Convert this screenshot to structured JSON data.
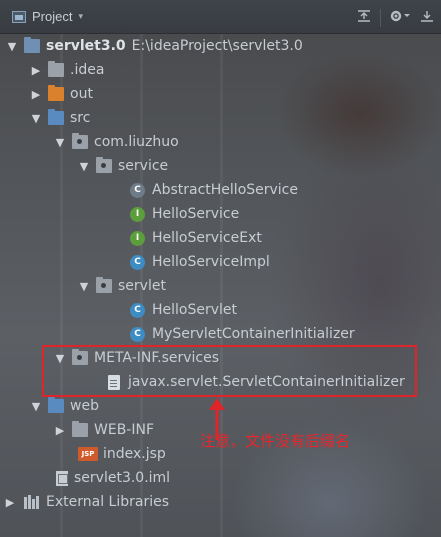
{
  "toolbar": {
    "title": "Project",
    "dropdown_caret": "▾",
    "icons": [
      "collapse-all-icon",
      "settings-icon",
      "hide-icon"
    ]
  },
  "tree": [
    {
      "id": "root",
      "label": "servlet3.0",
      "path": "E:\\ideaProject\\servlet3.0",
      "icon": "module-folder-icon",
      "expanded": true
    },
    {
      "id": "idea",
      "label": ".idea",
      "icon": "folder-icon",
      "expanded": false
    },
    {
      "id": "out",
      "label": "out",
      "icon": "excluded-folder-icon",
      "expanded": false
    },
    {
      "id": "src",
      "label": "src",
      "icon": "source-folder-icon",
      "expanded": true
    },
    {
      "id": "com_liuzhuo",
      "label": "com.liuzhuo",
      "icon": "package-icon",
      "expanded": true
    },
    {
      "id": "service",
      "label": "service",
      "icon": "package-icon",
      "expanded": true
    },
    {
      "id": "abstract_hello_service",
      "label": "AbstractHelloService",
      "icon": "abstract-class-icon",
      "badge": "C"
    },
    {
      "id": "hello_service",
      "label": "HelloService",
      "icon": "interface-icon",
      "badge": "I"
    },
    {
      "id": "hello_service_ext",
      "label": "HelloServiceExt",
      "icon": "interface-icon",
      "badge": "I"
    },
    {
      "id": "hello_service_impl",
      "label": "HelloServiceImpl",
      "icon": "class-icon",
      "badge": "C"
    },
    {
      "id": "servlet",
      "label": "servlet",
      "icon": "package-icon",
      "expanded": true
    },
    {
      "id": "hello_servlet",
      "label": "HelloServlet",
      "icon": "class-icon",
      "badge": "C"
    },
    {
      "id": "my_servlet_container_initializer",
      "label": "MyServletContainerInitializer",
      "icon": "class-icon",
      "badge": "C"
    },
    {
      "id": "meta_inf_services",
      "label": "META-INF.services",
      "icon": "package-icon",
      "expanded": true
    },
    {
      "id": "javax_file",
      "label": "javax.servlet.ServletContainerInitializer",
      "icon": "text-file-icon"
    },
    {
      "id": "web",
      "label": "web",
      "icon": "web-folder-icon",
      "expanded": true
    },
    {
      "id": "web_inf",
      "label": "WEB-INF",
      "icon": "folder-icon",
      "expanded": false
    },
    {
      "id": "index_jsp",
      "label": "index.jsp",
      "icon": "jsp-file-icon",
      "badge": "JSP"
    },
    {
      "id": "servlet_iml",
      "label": "servlet3.0.iml",
      "icon": "iml-file-icon"
    },
    {
      "id": "external_libraries",
      "label": "External Libraries",
      "icon": "libraries-icon",
      "expanded": false
    }
  ],
  "annotation": {
    "text": "注意，文件没有后缀名",
    "color": "#e0252a"
  },
  "colors": {
    "toolbar_bg": "#3c4146",
    "text": "#c8cdd2",
    "orange_folder": "#d9812c",
    "source_folder": "#5a8bc0",
    "class_badge": "#3d8cc4",
    "interface_badge": "#5d9e3c",
    "annotation": "#e0252a"
  }
}
